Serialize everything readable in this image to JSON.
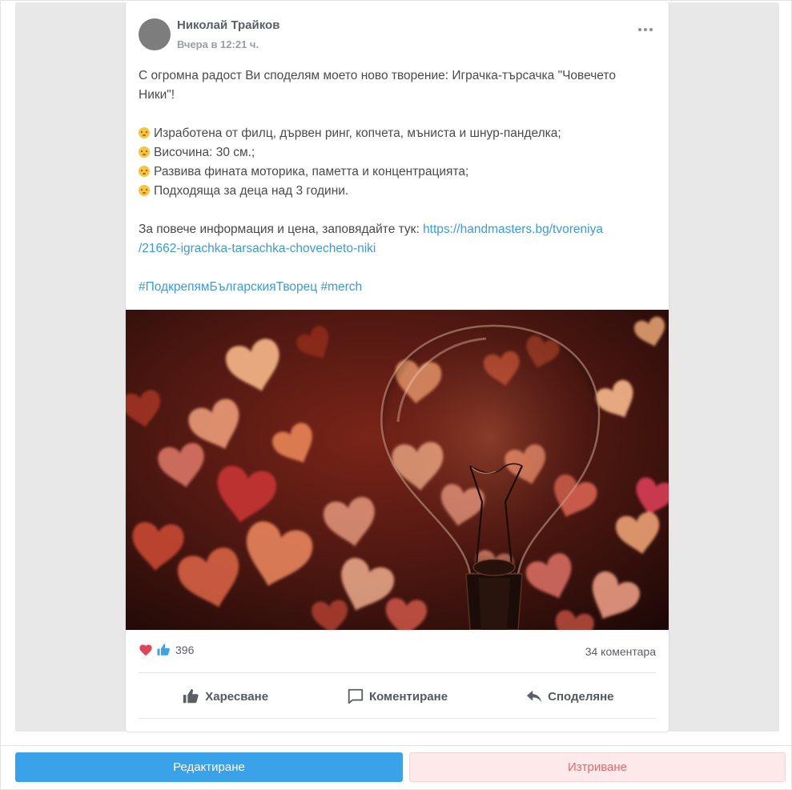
{
  "post": {
    "author": "Николай Трайков",
    "time": "Вчера в 12:21 ч.",
    "intro_line1": "С огромна радост Ви споделям моето ново творение: Играчка-търсачка \"Човечето",
    "intro_line2": "Ники\"!",
    "bullets": [
      "Изработена от филц, дървен ринг, копчета, мъниста и шнур-панделка;",
      "Височина: 30 см.;",
      "Развива фината моторика, паметта и концентрацията;",
      "Подходяща за деца над 3 години."
    ],
    "info_prefix": "За повече информация и цена, заповядайте тук: ",
    "link_line1": "https://handmasters.bg/tvoreniya",
    "link_line2": "/21662-igrachka-tarsachka-chovecheto-niki",
    "hashtags": "#ПодкрепямБългарскияТворец #merch"
  },
  "stats": {
    "likes": "396",
    "comments": "34 коментара"
  },
  "actions": {
    "like": "Харесване",
    "comment": "Коментиране",
    "share": "Споделяне"
  },
  "buttons": {
    "edit": "Редактиране",
    "delete": "Изтриване"
  },
  "icons": {
    "more": "more-horizontal-icon",
    "heart": "heart-icon",
    "thumb": "thumbs-up-icon",
    "comment": "comment-icon",
    "share": "share-icon",
    "bullet": "emoji-face-icon"
  },
  "colors": {
    "link": "#3b9ad9",
    "edit_button": "#3aa2e8",
    "delete_button_bg": "#fde9e9",
    "delete_button_text": "#e26a6a",
    "heart": "#e0445a",
    "thumb": "#3aa2e8"
  }
}
